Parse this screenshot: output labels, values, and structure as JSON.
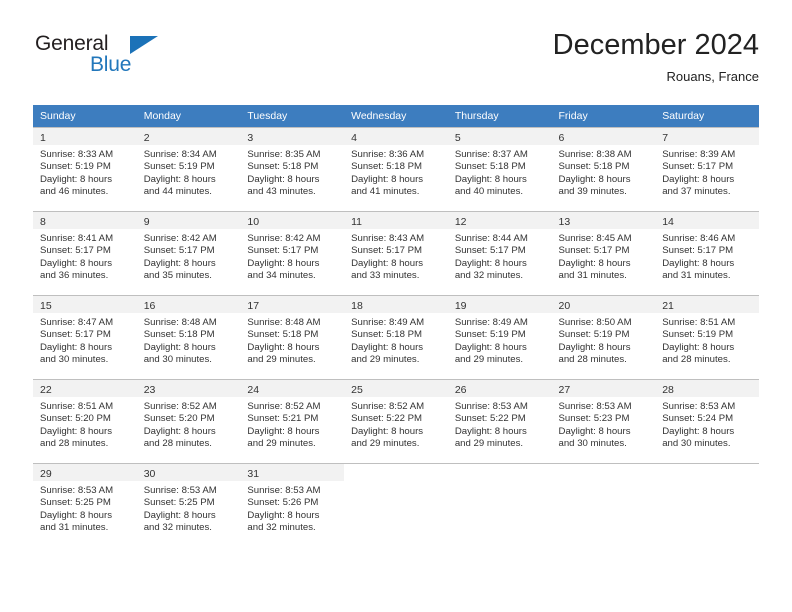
{
  "brand": {
    "name_part1": "General",
    "name_part2": "Blue",
    "triangle_color": "#1b72b8",
    "blue_text_color": "#2277bb"
  },
  "header": {
    "title": "December 2024",
    "subtitle": "Rouans, France"
  },
  "theme": {
    "header_bg": "#3d7dbf",
    "header_text": "#ffffff",
    "daynum_strip_bg": "#f2f2f2",
    "cell_border": "#bfbfbf",
    "body_text": "#333333"
  },
  "weekdays": [
    "Sunday",
    "Monday",
    "Tuesday",
    "Wednesday",
    "Thursday",
    "Friday",
    "Saturday"
  ],
  "labels": {
    "sunrise_prefix": "Sunrise:",
    "sunset_prefix": "Sunset:",
    "daylight_prefix": "Daylight:"
  },
  "weeks": [
    [
      {
        "day": "1",
        "sunrise": "Sunrise: 8:33 AM",
        "sunset": "Sunset: 5:19 PM",
        "daylight1": "Daylight: 8 hours",
        "daylight2": "and 46 minutes."
      },
      {
        "day": "2",
        "sunrise": "Sunrise: 8:34 AM",
        "sunset": "Sunset: 5:19 PM",
        "daylight1": "Daylight: 8 hours",
        "daylight2": "and 44 minutes."
      },
      {
        "day": "3",
        "sunrise": "Sunrise: 8:35 AM",
        "sunset": "Sunset: 5:18 PM",
        "daylight1": "Daylight: 8 hours",
        "daylight2": "and 43 minutes."
      },
      {
        "day": "4",
        "sunrise": "Sunrise: 8:36 AM",
        "sunset": "Sunset: 5:18 PM",
        "daylight1": "Daylight: 8 hours",
        "daylight2": "and 41 minutes."
      },
      {
        "day": "5",
        "sunrise": "Sunrise: 8:37 AM",
        "sunset": "Sunset: 5:18 PM",
        "daylight1": "Daylight: 8 hours",
        "daylight2": "and 40 minutes."
      },
      {
        "day": "6",
        "sunrise": "Sunrise: 8:38 AM",
        "sunset": "Sunset: 5:18 PM",
        "daylight1": "Daylight: 8 hours",
        "daylight2": "and 39 minutes."
      },
      {
        "day": "7",
        "sunrise": "Sunrise: 8:39 AM",
        "sunset": "Sunset: 5:17 PM",
        "daylight1": "Daylight: 8 hours",
        "daylight2": "and 37 minutes."
      }
    ],
    [
      {
        "day": "8",
        "sunrise": "Sunrise: 8:41 AM",
        "sunset": "Sunset: 5:17 PM",
        "daylight1": "Daylight: 8 hours",
        "daylight2": "and 36 minutes."
      },
      {
        "day": "9",
        "sunrise": "Sunrise: 8:42 AM",
        "sunset": "Sunset: 5:17 PM",
        "daylight1": "Daylight: 8 hours",
        "daylight2": "and 35 minutes."
      },
      {
        "day": "10",
        "sunrise": "Sunrise: 8:42 AM",
        "sunset": "Sunset: 5:17 PM",
        "daylight1": "Daylight: 8 hours",
        "daylight2": "and 34 minutes."
      },
      {
        "day": "11",
        "sunrise": "Sunrise: 8:43 AM",
        "sunset": "Sunset: 5:17 PM",
        "daylight1": "Daylight: 8 hours",
        "daylight2": "and 33 minutes."
      },
      {
        "day": "12",
        "sunrise": "Sunrise: 8:44 AM",
        "sunset": "Sunset: 5:17 PM",
        "daylight1": "Daylight: 8 hours",
        "daylight2": "and 32 minutes."
      },
      {
        "day": "13",
        "sunrise": "Sunrise: 8:45 AM",
        "sunset": "Sunset: 5:17 PM",
        "daylight1": "Daylight: 8 hours",
        "daylight2": "and 31 minutes."
      },
      {
        "day": "14",
        "sunrise": "Sunrise: 8:46 AM",
        "sunset": "Sunset: 5:17 PM",
        "daylight1": "Daylight: 8 hours",
        "daylight2": "and 31 minutes."
      }
    ],
    [
      {
        "day": "15",
        "sunrise": "Sunrise: 8:47 AM",
        "sunset": "Sunset: 5:17 PM",
        "daylight1": "Daylight: 8 hours",
        "daylight2": "and 30 minutes."
      },
      {
        "day": "16",
        "sunrise": "Sunrise: 8:48 AM",
        "sunset": "Sunset: 5:18 PM",
        "daylight1": "Daylight: 8 hours",
        "daylight2": "and 30 minutes."
      },
      {
        "day": "17",
        "sunrise": "Sunrise: 8:48 AM",
        "sunset": "Sunset: 5:18 PM",
        "daylight1": "Daylight: 8 hours",
        "daylight2": "and 29 minutes."
      },
      {
        "day": "18",
        "sunrise": "Sunrise: 8:49 AM",
        "sunset": "Sunset: 5:18 PM",
        "daylight1": "Daylight: 8 hours",
        "daylight2": "and 29 minutes."
      },
      {
        "day": "19",
        "sunrise": "Sunrise: 8:49 AM",
        "sunset": "Sunset: 5:19 PM",
        "daylight1": "Daylight: 8 hours",
        "daylight2": "and 29 minutes."
      },
      {
        "day": "20",
        "sunrise": "Sunrise: 8:50 AM",
        "sunset": "Sunset: 5:19 PM",
        "daylight1": "Daylight: 8 hours",
        "daylight2": "and 28 minutes."
      },
      {
        "day": "21",
        "sunrise": "Sunrise: 8:51 AM",
        "sunset": "Sunset: 5:19 PM",
        "daylight1": "Daylight: 8 hours",
        "daylight2": "and 28 minutes."
      }
    ],
    [
      {
        "day": "22",
        "sunrise": "Sunrise: 8:51 AM",
        "sunset": "Sunset: 5:20 PM",
        "daylight1": "Daylight: 8 hours",
        "daylight2": "and 28 minutes."
      },
      {
        "day": "23",
        "sunrise": "Sunrise: 8:52 AM",
        "sunset": "Sunset: 5:20 PM",
        "daylight1": "Daylight: 8 hours",
        "daylight2": "and 28 minutes."
      },
      {
        "day": "24",
        "sunrise": "Sunrise: 8:52 AM",
        "sunset": "Sunset: 5:21 PM",
        "daylight1": "Daylight: 8 hours",
        "daylight2": "and 29 minutes."
      },
      {
        "day": "25",
        "sunrise": "Sunrise: 8:52 AM",
        "sunset": "Sunset: 5:22 PM",
        "daylight1": "Daylight: 8 hours",
        "daylight2": "and 29 minutes."
      },
      {
        "day": "26",
        "sunrise": "Sunrise: 8:53 AM",
        "sunset": "Sunset: 5:22 PM",
        "daylight1": "Daylight: 8 hours",
        "daylight2": "and 29 minutes."
      },
      {
        "day": "27",
        "sunrise": "Sunrise: 8:53 AM",
        "sunset": "Sunset: 5:23 PM",
        "daylight1": "Daylight: 8 hours",
        "daylight2": "and 30 minutes."
      },
      {
        "day": "28",
        "sunrise": "Sunrise: 8:53 AM",
        "sunset": "Sunset: 5:24 PM",
        "daylight1": "Daylight: 8 hours",
        "daylight2": "and 30 minutes."
      }
    ],
    [
      {
        "day": "29",
        "sunrise": "Sunrise: 8:53 AM",
        "sunset": "Sunset: 5:25 PM",
        "daylight1": "Daylight: 8 hours",
        "daylight2": "and 31 minutes."
      },
      {
        "day": "30",
        "sunrise": "Sunrise: 8:53 AM",
        "sunset": "Sunset: 5:25 PM",
        "daylight1": "Daylight: 8 hours",
        "daylight2": "and 32 minutes."
      },
      {
        "day": "31",
        "sunrise": "Sunrise: 8:53 AM",
        "sunset": "Sunset: 5:26 PM",
        "daylight1": "Daylight: 8 hours",
        "daylight2": "and 32 minutes."
      },
      {
        "day": "",
        "sunrise": "",
        "sunset": "",
        "daylight1": "",
        "daylight2": ""
      },
      {
        "day": "",
        "sunrise": "",
        "sunset": "",
        "daylight1": "",
        "daylight2": ""
      },
      {
        "day": "",
        "sunrise": "",
        "sunset": "",
        "daylight1": "",
        "daylight2": ""
      },
      {
        "day": "",
        "sunrise": "",
        "sunset": "",
        "daylight1": "",
        "daylight2": ""
      }
    ]
  ]
}
